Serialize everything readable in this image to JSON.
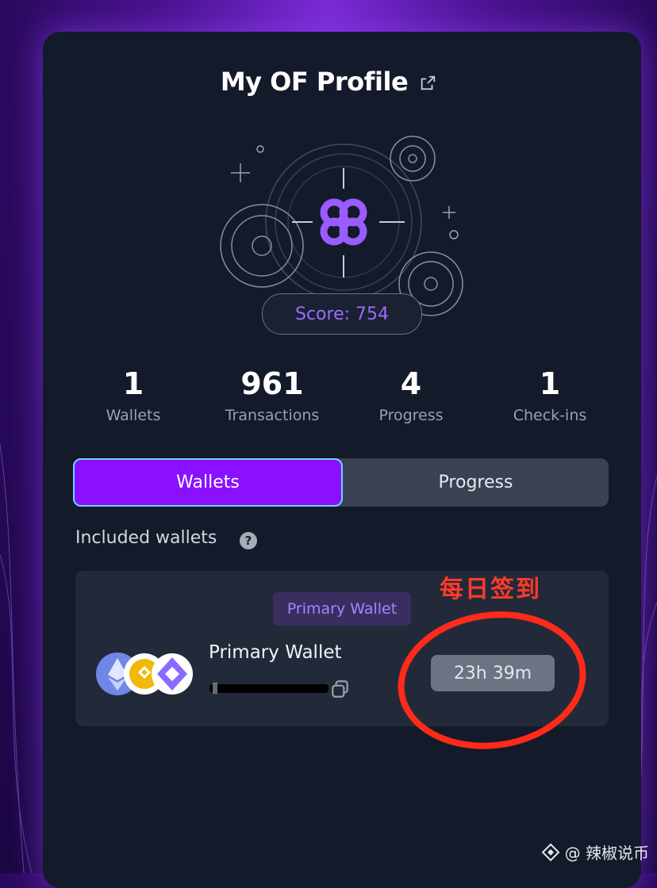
{
  "header": {
    "title": "My OF Profile",
    "external_link_icon": "external-link-icon"
  },
  "score": {
    "label": "Score: 754"
  },
  "stats": [
    {
      "value": "1",
      "label": "Wallets"
    },
    {
      "value": "961",
      "label": "Transactions"
    },
    {
      "value": "4",
      "label": "Progress"
    },
    {
      "value": "1",
      "label": "Check-ins"
    }
  ],
  "tabs": {
    "active": "Wallets",
    "inactive": "Progress"
  },
  "wallets_section": {
    "title": "Included wallets",
    "help_icon": "?"
  },
  "wallet": {
    "badge": "Primary Wallet",
    "name": "Primary Wallet",
    "timer": "23h 39m",
    "icons": [
      "ethereum-icon",
      "bnb-icon",
      "orbiter-icon"
    ]
  },
  "annotation": {
    "text": "每日签到",
    "color": "#ff3a2a"
  },
  "watermark": {
    "text": "@ 辣椒说币"
  },
  "colors": {
    "accent": "#8a10ff",
    "score_text": "#9c6cff",
    "card_bg": "#131a2a"
  }
}
